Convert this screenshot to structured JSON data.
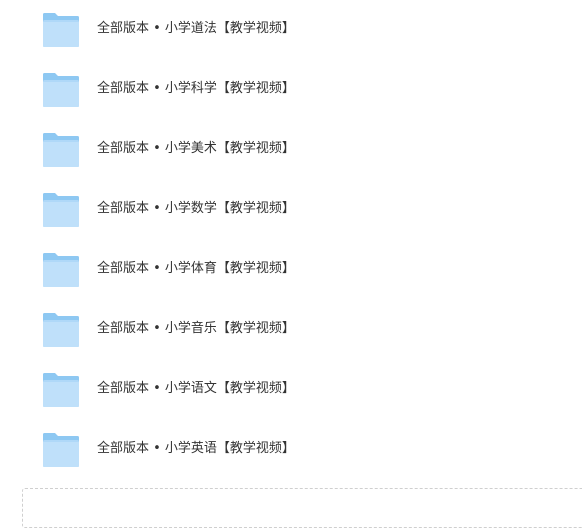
{
  "folder_icon": "folder-icon",
  "colors": {
    "folder_back": "#8ec8f2",
    "folder_front": "#bfe0fa",
    "text": "#333333"
  },
  "folders": [
    {
      "name": "全部版本 • 小学道法【教学视频】"
    },
    {
      "name": "全部版本 • 小学科学【教学视频】"
    },
    {
      "name": "全部版本 • 小学美术【教学视频】"
    },
    {
      "name": "全部版本 • 小学数学【教学视频】"
    },
    {
      "name": "全部版本 • 小学体育【教学视频】"
    },
    {
      "name": "全部版本 • 小学音乐【教学视频】"
    },
    {
      "name": "全部版本 • 小学语文【教学视频】"
    },
    {
      "name": "全部版本 • 小学英语【教学视频】"
    }
  ]
}
